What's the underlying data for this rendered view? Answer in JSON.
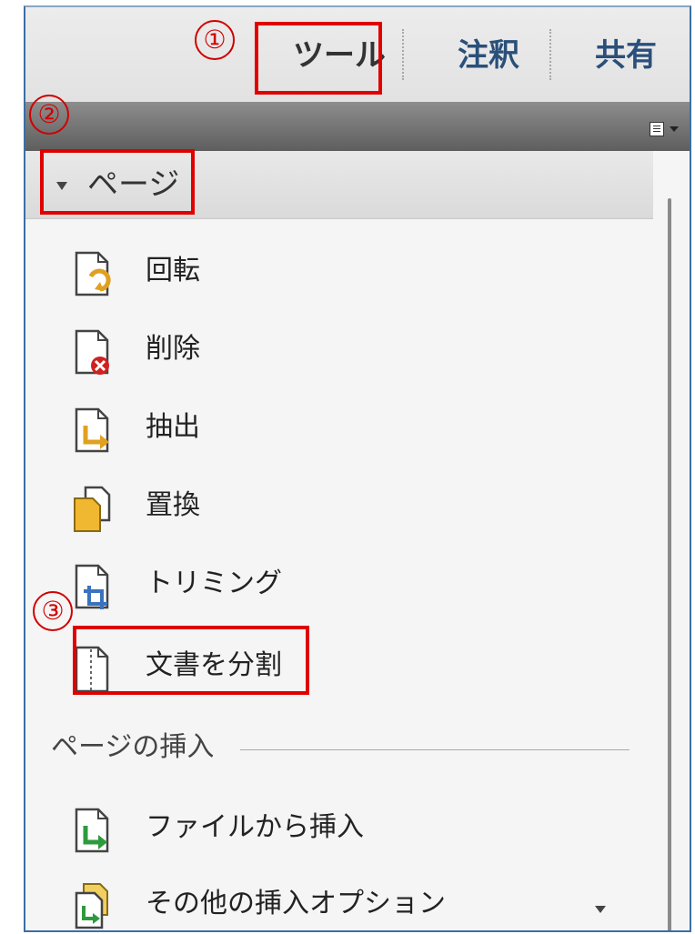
{
  "toolbar": {
    "tabs": [
      {
        "label": "ツール"
      },
      {
        "label": "注釈"
      },
      {
        "label": "共有"
      }
    ]
  },
  "section": {
    "title": "ページ",
    "items": [
      {
        "label": "回転",
        "icon": "rotate-page-icon"
      },
      {
        "label": "削除",
        "icon": "delete-page-icon"
      },
      {
        "label": "抽出",
        "icon": "extract-page-icon"
      },
      {
        "label": "置換",
        "icon": "replace-page-icon"
      },
      {
        "label": "トリミング",
        "icon": "crop-page-icon"
      },
      {
        "label": "文書を分割",
        "icon": "split-document-icon"
      }
    ]
  },
  "insert_group": {
    "label": "ページの挿入",
    "items": [
      {
        "label": "ファイルから挿入",
        "icon": "insert-from-file-icon"
      },
      {
        "label": "その他の挿入オプション",
        "icon": "more-insert-options-icon"
      }
    ]
  },
  "annotations": {
    "markers": [
      "①",
      "②",
      "③"
    ],
    "color": "#e00000"
  }
}
